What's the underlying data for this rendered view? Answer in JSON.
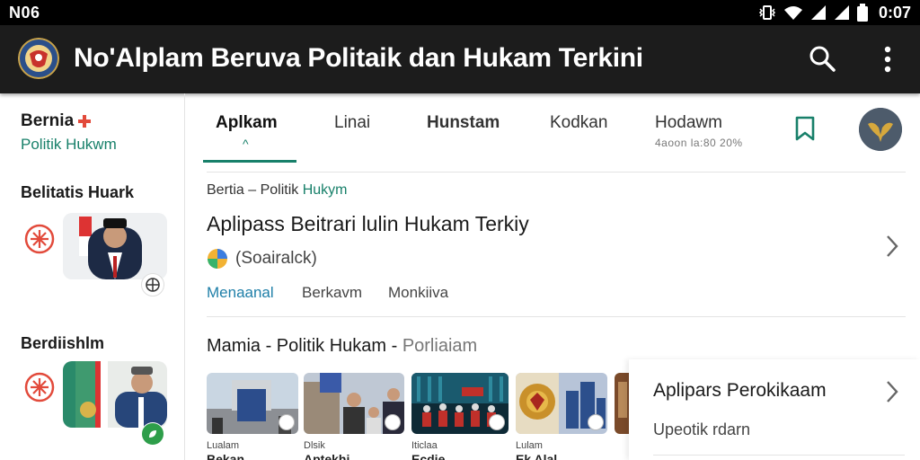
{
  "status_bar": {
    "carrier": "N06",
    "time": "0:07"
  },
  "app_bar": {
    "title": "No'Alplam Beruva Politaik dan Hukam Terkini"
  },
  "brand": {
    "name": "Bernia",
    "subtitle": "Politik Hukwm"
  },
  "left_sections": [
    {
      "title": "Belitatis Huark"
    },
    {
      "title": "Berdiishlm"
    }
  ],
  "tabs": [
    {
      "label": "Aplkam",
      "active": true
    },
    {
      "label": "Linai",
      "active": false
    },
    {
      "label": "Hunstam",
      "active": false
    },
    {
      "label": "Kodkan",
      "active": false
    },
    {
      "label": "Hodawm",
      "active": false
    }
  ],
  "tab_meta": "4aoon la:80 20%",
  "article": {
    "breadcrumb_prefix": "Bertia – Politik ",
    "breadcrumb_highlight": "Hukym",
    "headline": "Aplipass Beitrari lulin Hukam Terkiy",
    "source": "(Soairalck)",
    "links": [
      {
        "label": "Menaanal",
        "primary": true
      },
      {
        "label": "Berkavm",
        "primary": false
      },
      {
        "label": "Monkiiva",
        "primary": false
      }
    ]
  },
  "section2": {
    "title": "Mamia - Politik Hukam - ",
    "muted": "Porliaiam"
  },
  "cards": [
    {
      "label": "Lualam",
      "title": "Bekan"
    },
    {
      "label": "Dlsik",
      "title": "Aptekhi"
    },
    {
      "label": "Iticlaa",
      "title": "Ecdie"
    },
    {
      "label": "Lulam",
      "title": "Ek Alal"
    }
  ],
  "side_panel": {
    "title": "Aplipars Perokikaam",
    "subtitle": "Upeotik rdarn"
  },
  "colors": {
    "accent_green": "#18806a",
    "link_blue": "#1f7fa8",
    "appbar": "#1c1c1c",
    "badge_red": "#e24a3b"
  },
  "icons": [
    "wifi-icon",
    "signal-icon",
    "battery-icon",
    "search-icon",
    "more-vert-icon",
    "bookmark-icon",
    "chevron-right-icon",
    "sun-badge-icon"
  ]
}
